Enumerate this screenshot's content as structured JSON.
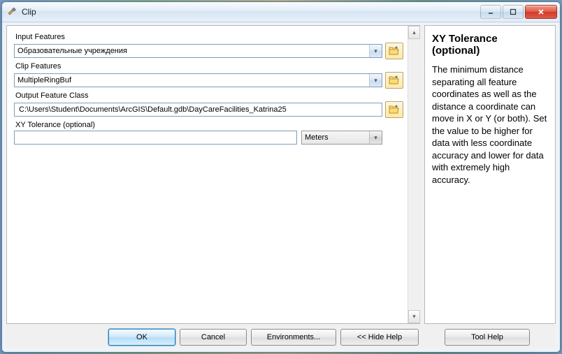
{
  "window": {
    "title": "Clip"
  },
  "form": {
    "inputFeatures": {
      "label": "Input Features",
      "value": "Образовательные учреждения"
    },
    "clipFeatures": {
      "label": "Clip Features",
      "value": "MultipleRingBuf"
    },
    "outputFC": {
      "label": "Output Feature Class",
      "value": "C:\\Users\\Student\\Documents\\ArcGIS\\Default.gdb\\DayCareFacilities_Katrina25"
    },
    "xyTolerance": {
      "label": "XY Tolerance (optional)",
      "value": "",
      "unit": "Meters"
    }
  },
  "buttons": {
    "ok": "OK",
    "cancel": "Cancel",
    "env": "Environments...",
    "hideHelp": "<< Hide Help",
    "toolHelp": "Tool Help"
  },
  "help": {
    "title": "XY Tolerance (optional)",
    "body": "The minimum distance separating all feature coordinates as well as the distance a coordinate can move in X or Y (or both). Set the value to be higher for data with less coordinate accuracy and lower for data with extremely high accuracy."
  }
}
